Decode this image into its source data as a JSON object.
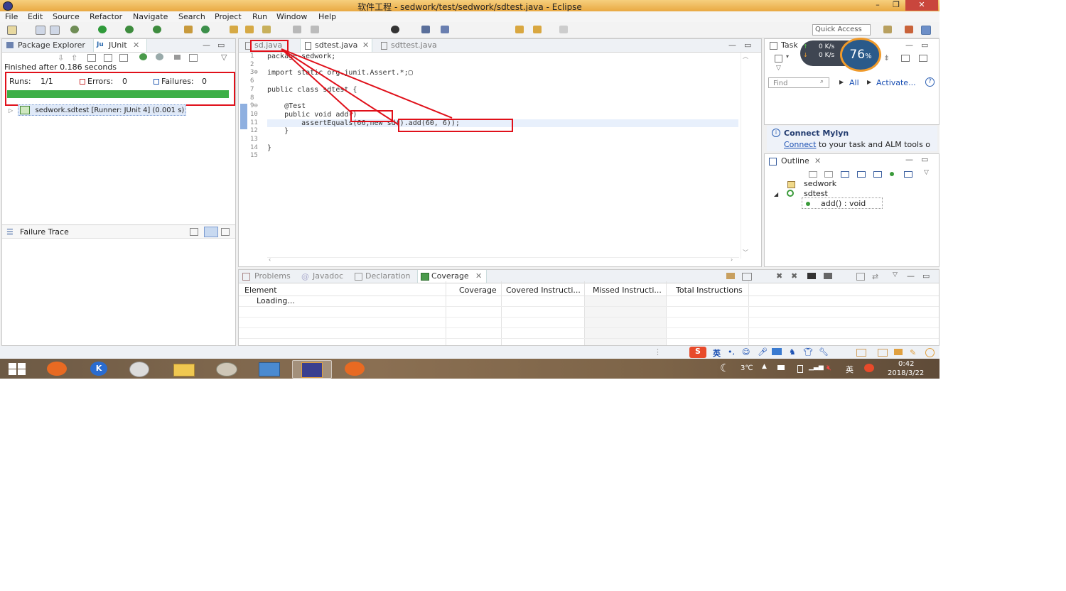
{
  "window": {
    "title": "软件工程 - sedwork/test/sedwork/sdtest.java - Eclipse"
  },
  "menu": [
    "File",
    "Edit",
    "Source",
    "Refactor",
    "Navigate",
    "Search",
    "Project",
    "Run",
    "Window",
    "Help"
  ],
  "quick_access": "Quick Access",
  "left": {
    "tabs": {
      "package_explorer": "Package Explorer",
      "junit": "JUnit"
    },
    "finished": "Finished after 0.186 seconds",
    "runs_label": "Runs:",
    "runs_value": "1/1",
    "errors_label": "Errors:",
    "errors_value": "0",
    "failures_label": "Failures:",
    "failures_value": "0",
    "progress": 1.0,
    "progress_color": "#3daf47",
    "test_item": "sedwork.sdtest [Runner: JUnit 4] (0.001 s)",
    "failure_trace": "Failure Trace"
  },
  "editor": {
    "tabs": [
      "sd.java",
      "sdtest.java",
      "sdttest.java"
    ],
    "line_numbers": [
      "1",
      "2",
      "3⊕",
      "6",
      "7",
      "8",
      "9⊖",
      "10",
      "11",
      "12",
      "13",
      "14",
      "15"
    ],
    "lines": [
      "package sedwork;",
      "",
      "import static org.junit.Assert.*;▢",
      "",
      "public class sdtest {",
      "",
      "    @Test",
      "    public void add()",
      "        assertEquals(66,new sd().add(60, 6));",
      "    }",
      "",
      "}",
      ""
    ]
  },
  "right": {
    "task_tab": "Task",
    "net_up": "0 K/s",
    "net_down": "0 K/s",
    "cpu": "76",
    "cpu_unit": "%",
    "find_placeholder": "Find",
    "all": "All",
    "activate": "Activate...",
    "mylyn_title": "Connect Mylyn",
    "mylyn_link": "Connect",
    "mylyn_text": " to your task and ALM tools o",
    "outline_tab": "Outline",
    "outline_items": [
      "sedwork",
      "sdtest",
      "add() : void"
    ]
  },
  "bottom": {
    "tabs": [
      "Problems",
      "Javadoc",
      "Declaration",
      "Coverage"
    ],
    "columns": [
      "Element",
      "Coverage",
      "Covered Instructi...",
      "Missed Instructi...",
      "Total Instructions"
    ],
    "loading": "Loading..."
  },
  "tray": {
    "ime_lang": "英",
    "ime_mode": "中",
    "temperature": "3℃",
    "time": "0:42",
    "date": "2018/3/22",
    "lang": "英"
  }
}
